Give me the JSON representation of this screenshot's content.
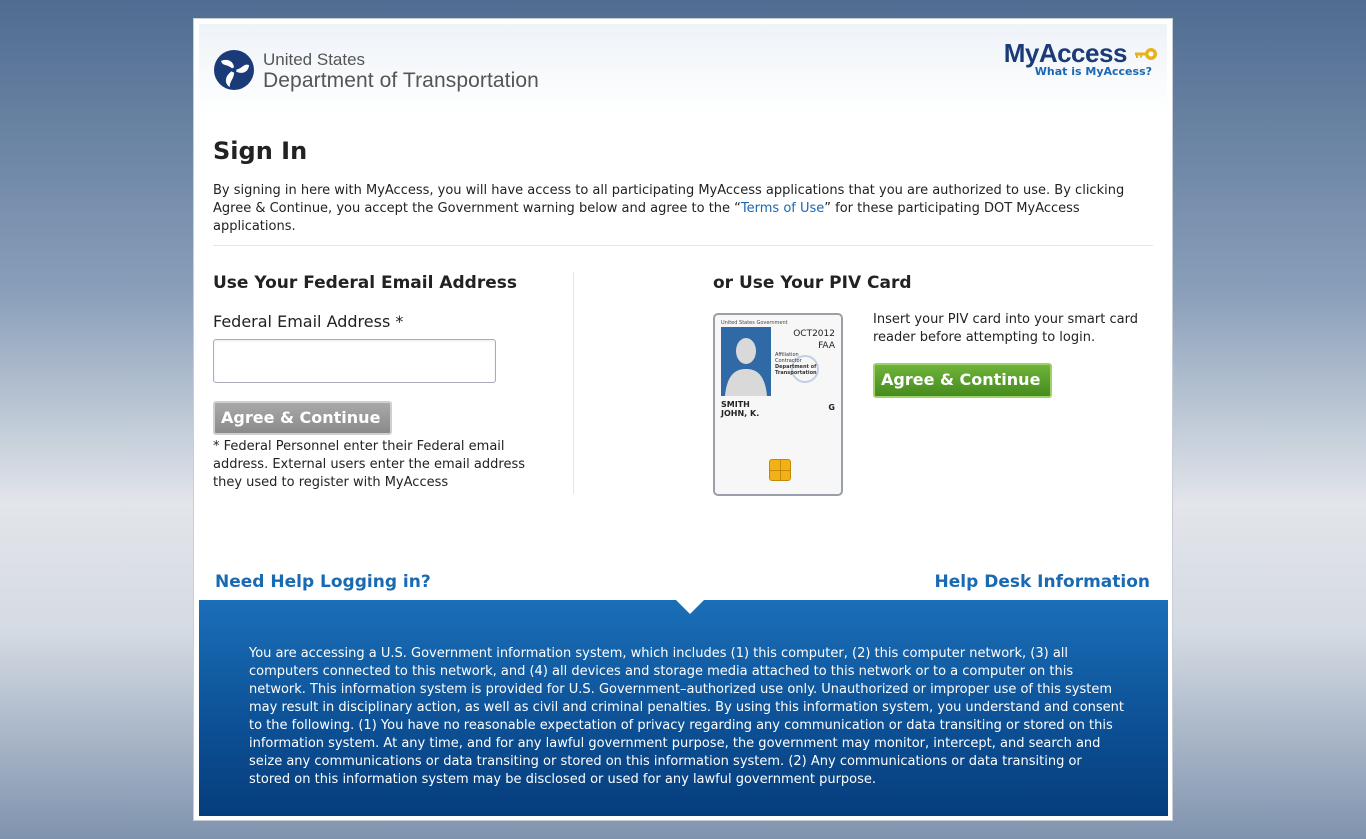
{
  "header": {
    "org_line1": "United States",
    "org_line2": "Department of Transportation",
    "brand": "MyAccess",
    "brand_link": "What is MyAccess?"
  },
  "main": {
    "title": "Sign In",
    "intro_part1": "By signing in here with MyAccess, you will have access to all participating MyAccess applications that you are authorized to use. By clicking Agree & Continue, you accept the Government warning below and agree to the “",
    "terms_link": "Terms of Use",
    "intro_part2": "” for these participating DOT MyAccess applications."
  },
  "email_section": {
    "heading": "Use Your Federal Email Address",
    "field_label": "Federal Email Address *",
    "field_value": "",
    "button_label": "Agree & Continue",
    "note": "* Federal Personnel enter their Federal email address. External users enter the email address they used to register with MyAccess"
  },
  "piv_section": {
    "heading": "or Use Your PIV Card",
    "instructions": "Insert your PIV card into your smart card reader before attempting to login.",
    "button_label": "Agree & Continue",
    "card": {
      "gov": "United States Government",
      "date": "OCT2012",
      "agency": "FAA",
      "affiliation_label": "Affiliation",
      "affiliation": "Contractor",
      "dept_line1": "Department of",
      "dept_line2": "Transportation",
      "name_line1": "SMITH",
      "name_line2": "JOHN, K.",
      "badge": "G"
    }
  },
  "help": {
    "left": "Need Help Logging in?",
    "right": "Help Desk Information"
  },
  "warning": {
    "text": "You are accessing a U.S. Government information system, which includes (1) this computer, (2) this computer network, (3) all computers connected to this network, and (4) all devices and storage media attached to this network or to a computer on this network. This information system is provided for U.S. Government–authorized use only. Unauthorized or improper use of this system may result in disciplinary action, as well as civil and criminal penalties. By using this information system, you understand and consent to the following. (1) You have no reasonable expectation of privacy regarding any communication or data transiting or stored on this information system. At any time, and for any lawful government purpose, the government may monitor, intercept, and search and seize any communications or data transiting or stored on this information system. (2) Any communications or data transiting or stored on this information system may be disclosed or used for any lawful government purpose."
  },
  "colors": {
    "link_blue": "#1a67b3",
    "brand_navy": "#1b3a78",
    "green_button": "#5aa12b",
    "gray_button": "#9a9a9a",
    "warning_blue": "#0c4f94"
  },
  "icons": [
    "dot-logo-icon",
    "key-icon",
    "chevron-right-icon",
    "person-silhouette-icon",
    "smart-chip-icon"
  ]
}
